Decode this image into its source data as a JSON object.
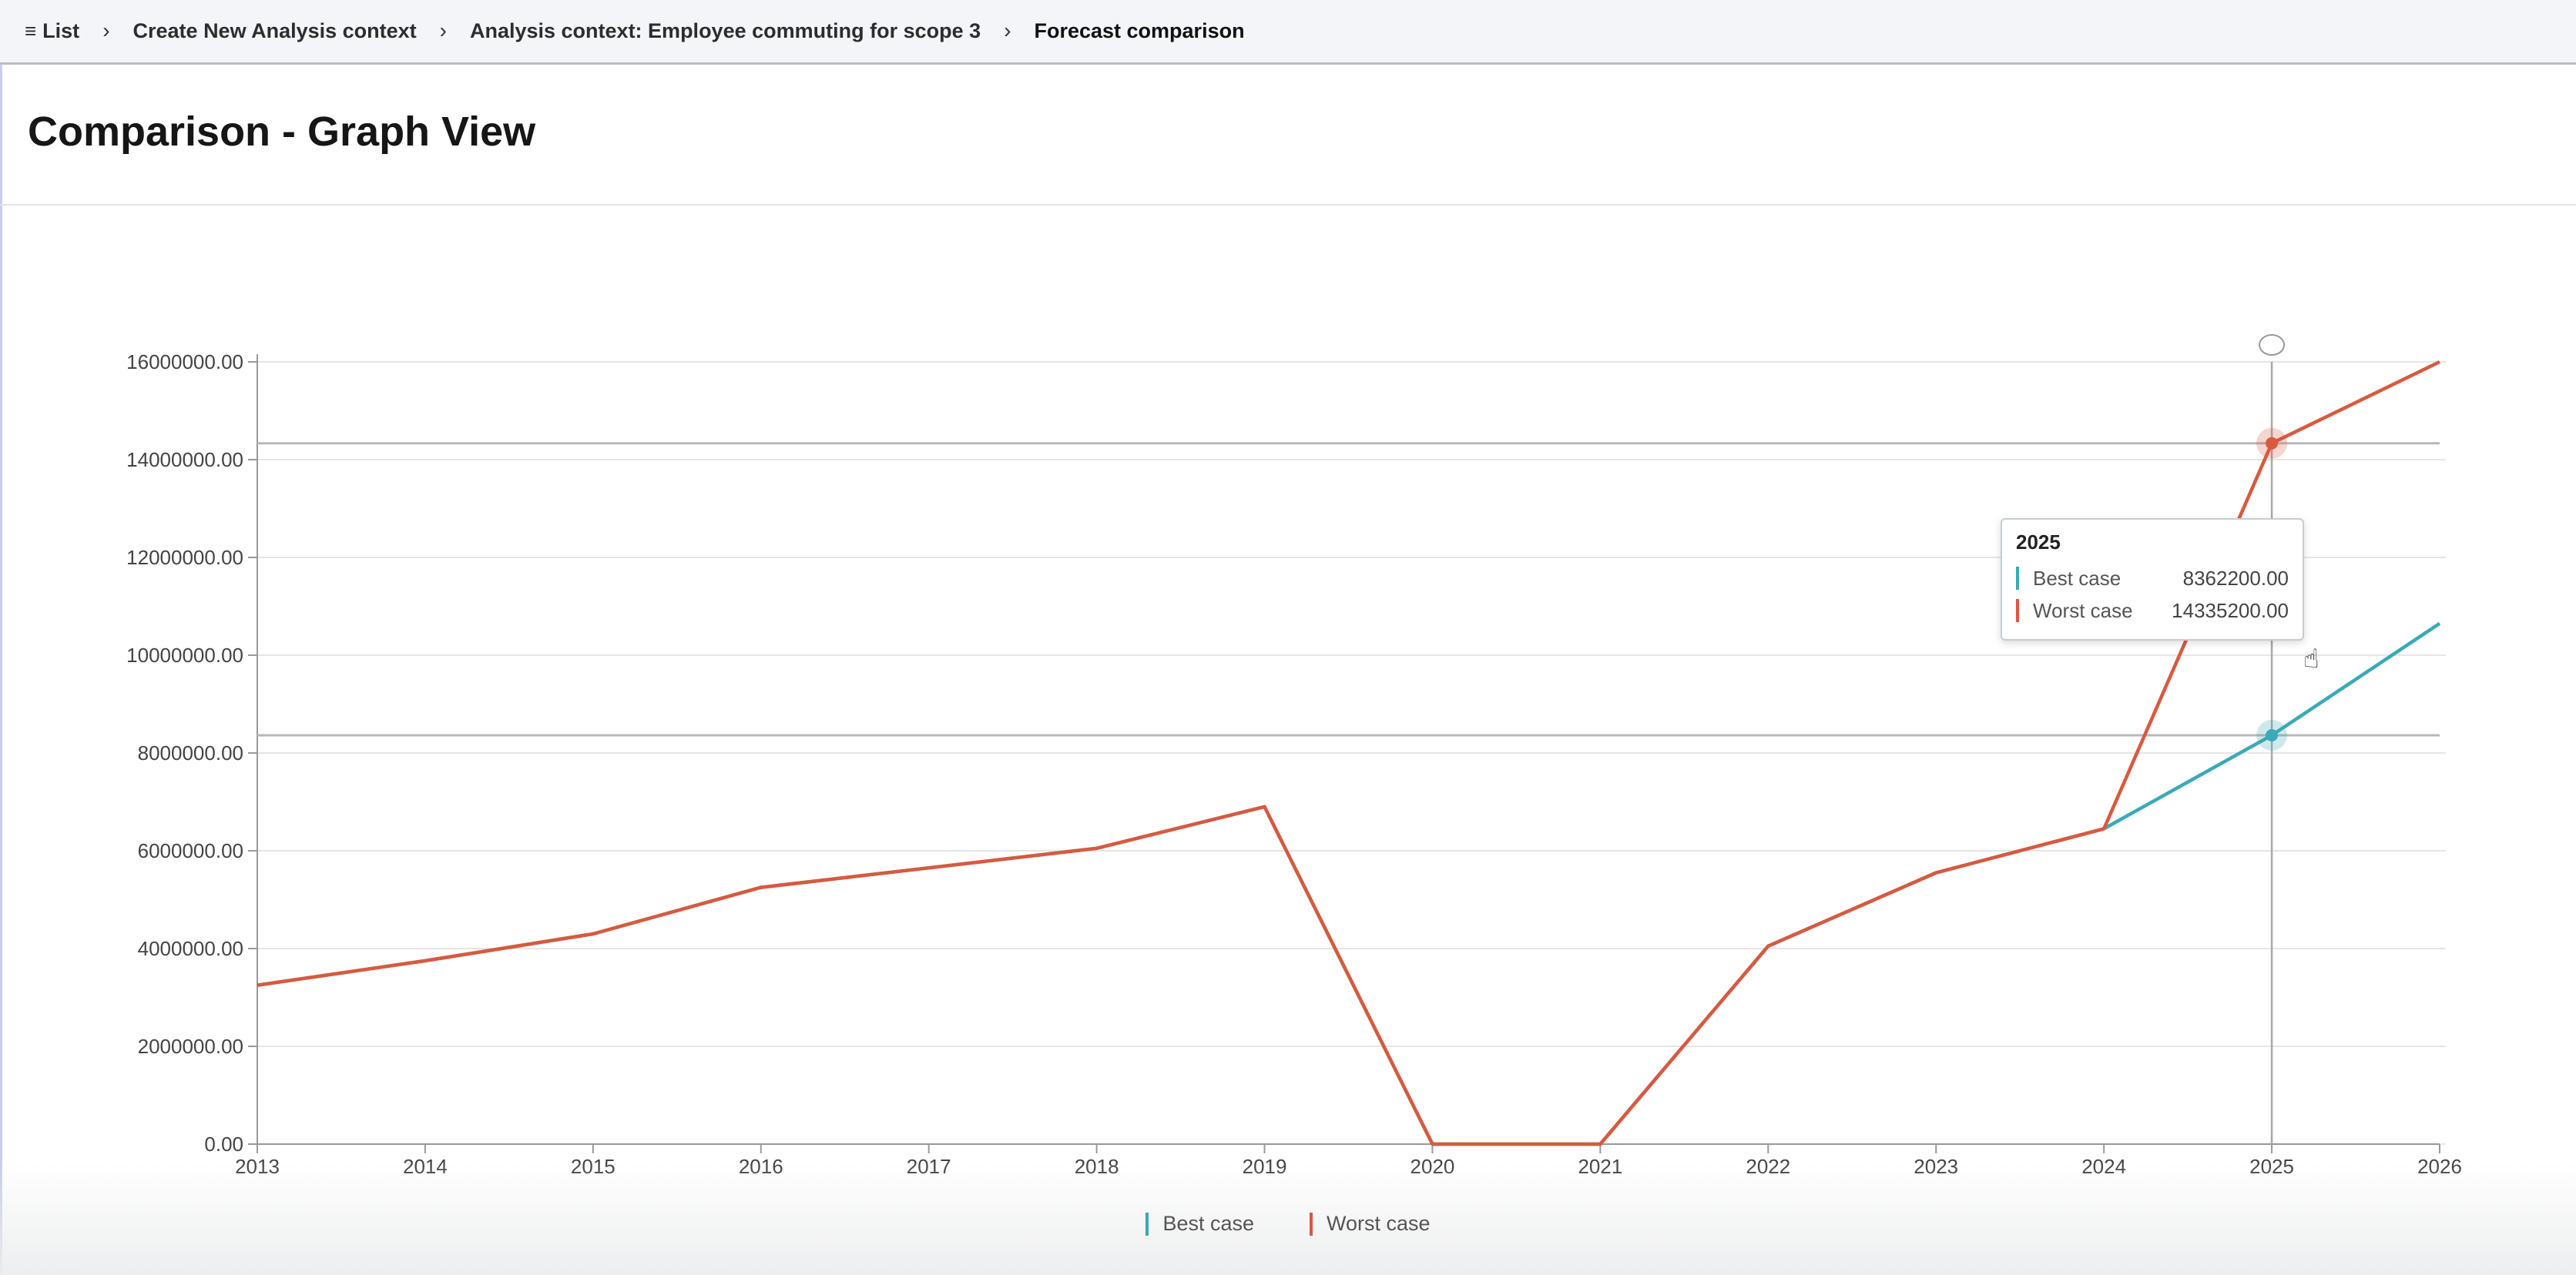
{
  "breadcrumb": {
    "items": [
      "List",
      "Create New Analysis context",
      "Analysis context: Employee commuting for scope 3",
      "Forecast comparison"
    ],
    "menu_icon": "hamburger-icon"
  },
  "page": {
    "title": "Comparison - Graph View"
  },
  "colors": {
    "best_case": "#3aa9b8",
    "worst_case": "#d9593e",
    "grid": "#e6e6e6",
    "axis": "#999999"
  },
  "chart_data": {
    "type": "line",
    "title": "",
    "xlabel": "",
    "ylabel": "",
    "x": [
      2013,
      2014,
      2015,
      2016,
      2017,
      2018,
      2019,
      2020,
      2021,
      2022,
      2023,
      2024,
      2025,
      2026
    ],
    "x_tick_labels": [
      "2013",
      "2014",
      "2015",
      "2016",
      "2017",
      "2018",
      "2019",
      "2020",
      "2021",
      "2022",
      "2023",
      "2024",
      "2025",
      "2026"
    ],
    "y_tick_labels": [
      "0.00",
      "2000000.00",
      "4000000.00",
      "6000000.00",
      "8000000.00",
      "10000000.00",
      "12000000.00",
      "14000000.00",
      "16000000.00"
    ],
    "ylim": [
      0,
      16000000
    ],
    "grid": true,
    "legend_position": "bottom-center",
    "series": [
      {
        "name": "Best case",
        "values": [
          3250000,
          3750000,
          4300000,
          5250000,
          5650000,
          6050000,
          6900000,
          0,
          0,
          4050000,
          5550000,
          6450000,
          8362200,
          10650000
        ]
      },
      {
        "name": "Worst case",
        "values": [
          3250000,
          3750000,
          4300000,
          5250000,
          5650000,
          6050000,
          6900000,
          0,
          0,
          4050000,
          5550000,
          6450000,
          14335200,
          16000000
        ]
      }
    ],
    "tooltip": {
      "year": "2025",
      "rows": [
        {
          "name": "Best case",
          "value": "8362200.00"
        },
        {
          "name": "Worst case",
          "value": "14335200.00"
        }
      ]
    },
    "hover_x": 2025
  }
}
